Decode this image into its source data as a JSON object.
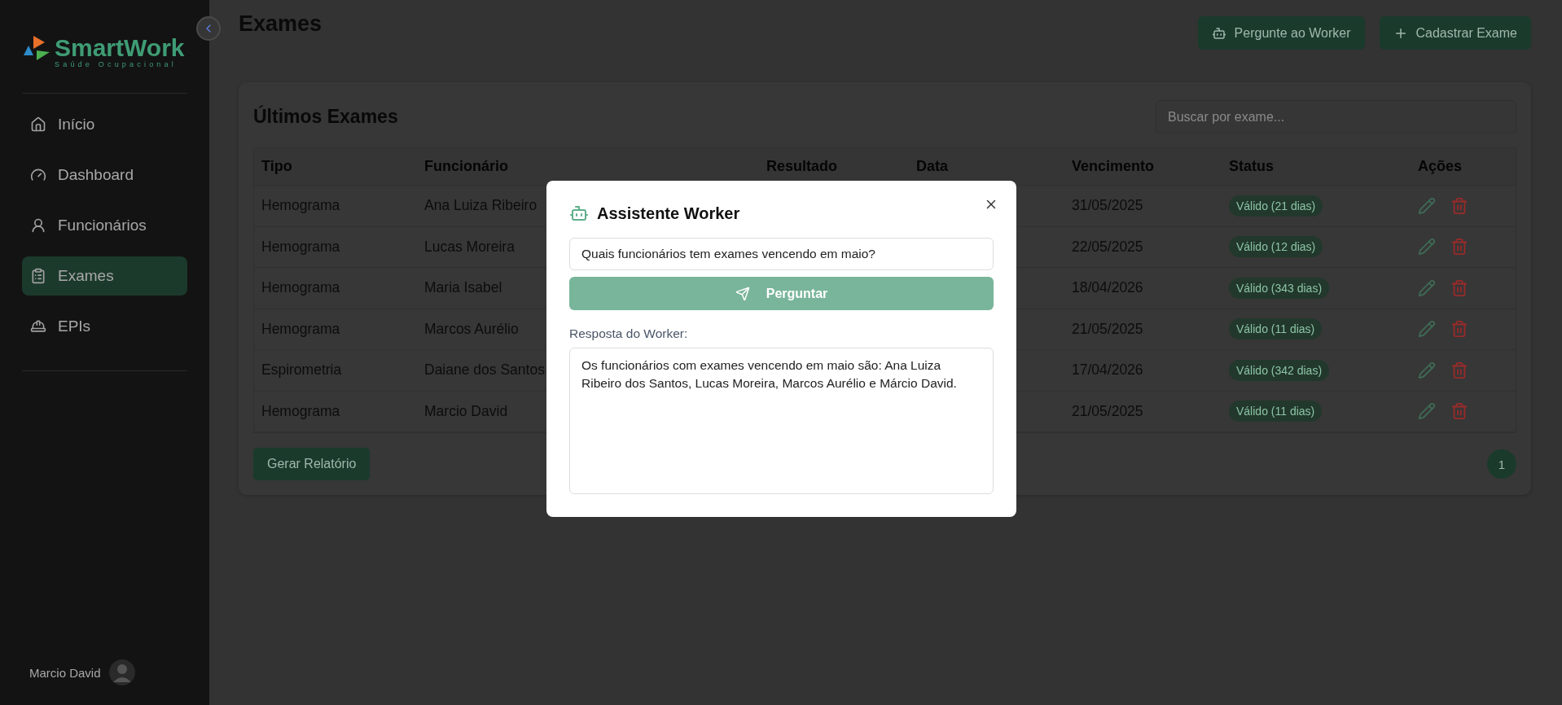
{
  "sidebar": {
    "logo": {
      "name": "SmartWork",
      "tagline": "Saúde Ocupacional"
    },
    "items": [
      {
        "label": "Início",
        "kind": "home",
        "selected": false
      },
      {
        "label": "Dashboard",
        "kind": "gauge",
        "selected": false
      },
      {
        "label": "Funcionários",
        "kind": "worker",
        "selected": false
      },
      {
        "label": "Exames",
        "kind": "clipboard",
        "selected": true
      },
      {
        "label": "EPIs",
        "kind": "helmet",
        "selected": false
      }
    ],
    "user": {
      "name": "Marcio David"
    }
  },
  "header": {
    "title": "Exames",
    "buttons": [
      {
        "label": "Pergunte ao Worker",
        "kind": "bot"
      },
      {
        "label": "Cadastrar Exame",
        "kind": "plus"
      }
    ]
  },
  "card": {
    "title": "Últimos Exames",
    "search": {
      "placeholder": "Buscar por exame..."
    },
    "table": {
      "columns": [
        "Tipo",
        "Funcionário",
        "Resultado",
        "Data",
        "Vencimento",
        "Status",
        "Ações"
      ],
      "rows": [
        {
          "tipo": "Hemograma",
          "funcionario": "Ana Luiza Ribeiro",
          "vencimento": "31/05/2025",
          "status": "Válido (21 dias)"
        },
        {
          "tipo": "Hemograma",
          "funcionario": "Lucas Moreira",
          "vencimento": "22/05/2025",
          "status": "Válido (12 dias)"
        },
        {
          "tipo": "Hemograma",
          "funcionario": "Maria Isabel",
          "vencimento": "18/04/2026",
          "status": "Válido (343 dias)"
        },
        {
          "tipo": "Hemograma",
          "funcionario": "Marcos Aurélio",
          "vencimento": "21/05/2025",
          "status": "Válido (11 dias)"
        },
        {
          "tipo": "Espirometria",
          "funcionario": "Daiane dos Santos",
          "vencimento": "17/04/2026",
          "status": "Válido (342 dias)"
        },
        {
          "tipo": "Hemograma",
          "funcionario": "Marcio David",
          "vencimento": "21/05/2025",
          "status": "Válido (11 dias)"
        }
      ]
    },
    "report_button": "Gerar Relatório",
    "pagination": [
      {
        "label": "1",
        "selected": true
      }
    ]
  },
  "modal": {
    "title": "Assistente Worker",
    "question": "Quais funcionários tem exames vencendo em maio?",
    "ask_button": "Perguntar",
    "answer_label": "Resposta do Worker:",
    "answer": "Os funcionários com exames vencendo em maio são: Ana Luiza Ribeiro dos Santos, Lucas Moreira, Marcos Aurélio e Márcio David."
  }
}
